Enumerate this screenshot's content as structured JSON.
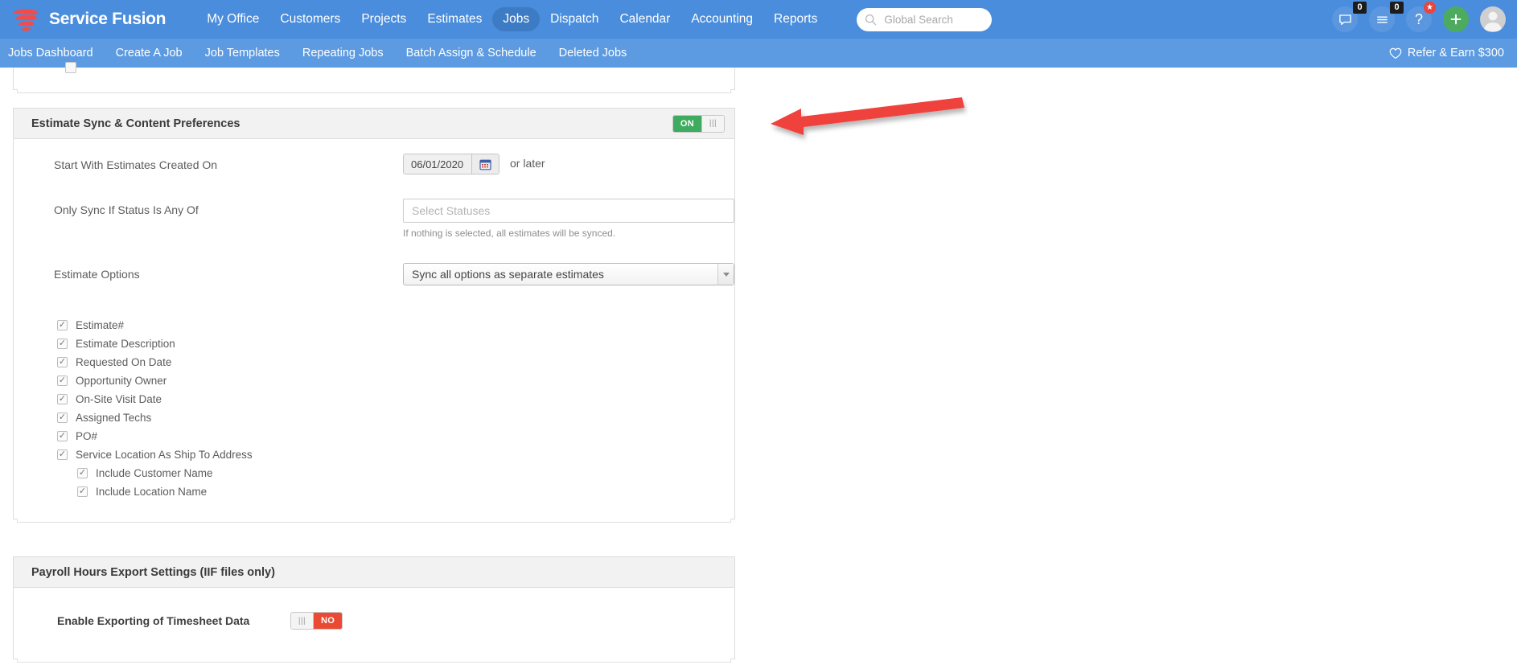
{
  "brand": {
    "name": "Service Fusion"
  },
  "mainnav": {
    "items": [
      {
        "label": "My Office",
        "active": false
      },
      {
        "label": "Customers",
        "active": false
      },
      {
        "label": "Projects",
        "active": false
      },
      {
        "label": "Estimates",
        "active": false
      },
      {
        "label": "Jobs",
        "active": true
      },
      {
        "label": "Dispatch",
        "active": false
      },
      {
        "label": "Calendar",
        "active": false
      },
      {
        "label": "Accounting",
        "active": false
      },
      {
        "label": "Reports",
        "active": false
      }
    ]
  },
  "search": {
    "placeholder": "Global Search",
    "value": "",
    "icon": "search-icon"
  },
  "topicons": {
    "messages": {
      "icon": "chat-bubble-icon",
      "badge": "0"
    },
    "notifications": {
      "icon": "list-lines-icon",
      "badge": "0"
    },
    "help": {
      "icon": "question-mark-icon",
      "badge": "star"
    },
    "add": {
      "icon": "plus-icon"
    },
    "avatar": {
      "icon": "user-avatar-icon"
    }
  },
  "subnav": {
    "items": [
      {
        "label": "Jobs Dashboard"
      },
      {
        "label": "Create A Job"
      },
      {
        "label": "Job Templates"
      },
      {
        "label": "Repeating Jobs"
      },
      {
        "label": "Batch Assign & Schedule"
      },
      {
        "label": "Deleted Jobs"
      }
    ],
    "refer": {
      "label": "Refer & Earn $300",
      "icon": "heart-icon"
    }
  },
  "estimate_panel": {
    "title": "Estimate Sync & Content Preferences",
    "toggle": {
      "state": "ON",
      "on_label": "ON",
      "handle": "|||"
    },
    "rows": [
      {
        "label": "Start With Estimates Created On",
        "date_value": "06/01/2020",
        "date_icon": "calendar-icon",
        "suffix": "or later"
      },
      {
        "label": "Only Sync If Status Is Any Of",
        "placeholder": "Select Statuses",
        "value": "",
        "hint": "If nothing is selected, all estimates will be synced."
      },
      {
        "label": "Estimate Options",
        "selected": "Sync all options as separate estimates",
        "options": [
          "Sync all options as separate estimates"
        ]
      }
    ],
    "checkboxes": [
      {
        "label": "Estimate#",
        "checked": true,
        "indent": false
      },
      {
        "label": "Estimate Description",
        "checked": true,
        "indent": false
      },
      {
        "label": "Requested On Date",
        "checked": true,
        "indent": false
      },
      {
        "label": "Opportunity Owner",
        "checked": true,
        "indent": false
      },
      {
        "label": "On-Site Visit Date",
        "checked": true,
        "indent": false
      },
      {
        "label": "Assigned Techs",
        "checked": true,
        "indent": false
      },
      {
        "label": "PO#",
        "checked": true,
        "indent": false
      },
      {
        "label": "Service Location As Ship To Address",
        "checked": true,
        "indent": false
      },
      {
        "label": "Include Customer Name",
        "checked": true,
        "indent": true
      },
      {
        "label": "Include Location Name",
        "checked": true,
        "indent": true
      }
    ],
    "check_glyph": "✓"
  },
  "payroll_panel": {
    "title": "Payroll Hours Export Settings (IIF files only)",
    "row_label": "Enable Exporting of Timesheet Data",
    "toggle": {
      "state": "NO",
      "no_label": "NO",
      "handle": "|||"
    }
  },
  "annotation": {
    "type": "arrow",
    "color": "#f0423c",
    "points_to": "estimate-sync-toggle"
  },
  "colors": {
    "topbar": "#4a8ddc",
    "subbar": "#5c9ae1",
    "accent_green": "#3fab5f",
    "accent_red": "#ea4a33",
    "brand_red": "#ef4d4d",
    "panel_head": "#f2f2f2"
  }
}
